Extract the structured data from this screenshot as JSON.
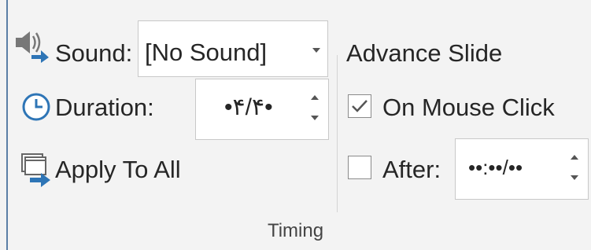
{
  "sound": {
    "label": "Sound:",
    "value": "[No Sound]"
  },
  "duration": {
    "label": "Duration:",
    "value": "•۴/۴•"
  },
  "apply_all": {
    "label": "Apply To All"
  },
  "advance": {
    "title": "Advance Slide",
    "on_mouse_click": {
      "label": "On Mouse Click",
      "checked": true
    },
    "after": {
      "label": "After:",
      "checked": false,
      "value": "••:••/••"
    }
  },
  "group": {
    "label": "Timing"
  },
  "colors": {
    "accent": "#2e75b6",
    "background": "#f3f3f3",
    "border": "#5b7fa6"
  },
  "icons": {
    "sound": "speaker-arrow-icon",
    "duration": "clock-icon",
    "apply_all": "apply-all-icon",
    "dropdown": "chevron-down-icon",
    "spinner": "spinner-arrows-icon",
    "checkmark": "checkmark-icon"
  }
}
